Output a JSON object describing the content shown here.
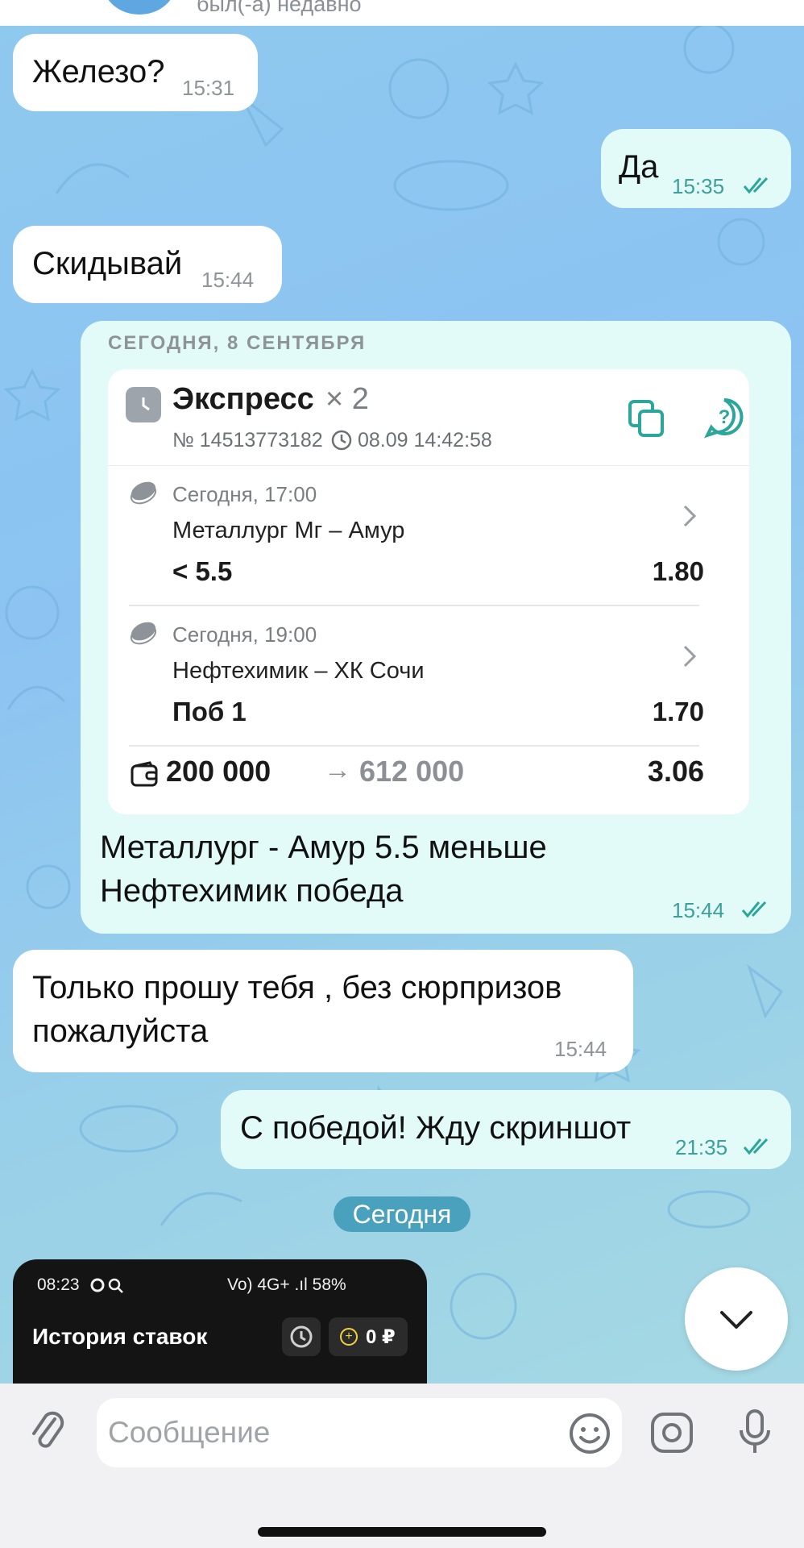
{
  "header": {
    "status": "был(-а) недавно"
  },
  "messages": [
    {
      "text": "Железо?",
      "time": "15:31"
    },
    {
      "text": "Да",
      "time": "15:35"
    },
    {
      "text": "Скидывай",
      "time": "15:44"
    },
    {
      "date_header": "СЕГОДНЯ, 8 СЕНТЯБРЯ",
      "caption_line1": "Металлург - Амур 5.5 меньше",
      "caption_line2": "Нефтехимик победа",
      "time": "15:44"
    },
    {
      "line1": "Только прошу тебя , без сюрпризов",
      "line2": "пожалуйста",
      "time": "15:44"
    },
    {
      "text": "С победой! Жду скриншот",
      "time": "21:35"
    }
  ],
  "bet_card": {
    "title": "Экспресс",
    "multiplier": "× 2",
    "number": "№ 14513773182",
    "datetime": "08.09 14:42:58",
    "legs": [
      {
        "when": "Сегодня, 17:00",
        "match": "Металлург Мг – Амур",
        "pick": "< 5.5",
        "odd": "1.80"
      },
      {
        "when": "Сегодня, 19:00",
        "match": "Нефтехимик – ХК Сочи",
        "pick": "Поб 1",
        "odd": "1.70"
      }
    ],
    "stake": "200 000",
    "arrow": "→",
    "payout": "612 000",
    "total_odd": "3.06"
  },
  "date_separator": "Сегодня",
  "screenshot_preview": {
    "time": "08:23",
    "status": "Vo) 4G+ .ıl 58%",
    "title": "История ставок",
    "balance": "0 ₽",
    "coin_glyph": "+"
  },
  "composer": {
    "placeholder": "Сообщение"
  },
  "icons": [
    "clock-icon",
    "copy-icon",
    "help-icon",
    "hockey-puck-icon",
    "chevron-right-icon",
    "wallet-icon",
    "history-icon",
    "chevron-down-icon",
    "paperclip-icon",
    "emoji-icon",
    "camera-icon",
    "microphone-icon",
    "double-check-icon"
  ],
  "colors": {
    "outgoing_bubble": "#e2fbf8",
    "incoming_bubble": "#ffffff",
    "accent_teal": "#2aa79a",
    "date_pill": "#4aa1bd"
  }
}
